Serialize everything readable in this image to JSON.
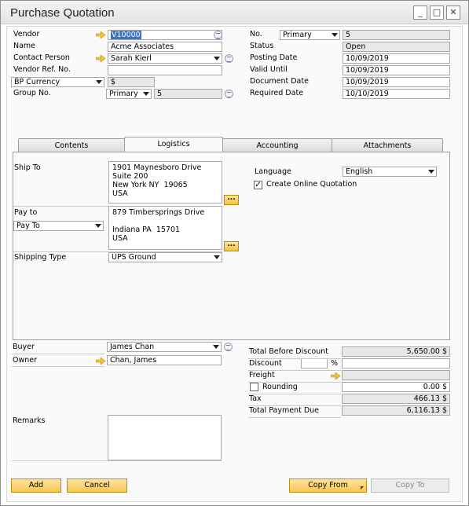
{
  "window": {
    "title": "Purchase Quotation"
  },
  "header_left": {
    "vendor_label": "Vendor",
    "vendor_value": "V10000",
    "name_label": "Name",
    "name_value": "Acme Associates",
    "contact_label": "Contact Person",
    "contact_value": "Sarah Kierl",
    "vendor_ref_label": "Vendor Ref. No.",
    "vendor_ref_value": "",
    "currency_select": "BP Currency",
    "currency_value": "$",
    "group_label": "Group No.",
    "group_select": "Primary",
    "group_value": "5"
  },
  "header_right": {
    "no_label": "No.",
    "no_series": "Primary",
    "no_value": "5",
    "status_label": "Status",
    "status_value": "Open",
    "posting_label": "Posting Date",
    "posting_value": "10/09/2019",
    "valid_label": "Valid Until",
    "valid_value": "10/09/2019",
    "document_label": "Document Date",
    "document_value": "10/09/2019",
    "required_label": "Required Date",
    "required_value": "10/10/2019"
  },
  "tabs": [
    {
      "label": "Contents"
    },
    {
      "label": "Logistics"
    },
    {
      "label": "Accounting"
    },
    {
      "label": "Attachments"
    }
  ],
  "logistics": {
    "ship_to_label": "Ship To",
    "ship_to_address": "1901 Maynesboro Drive\nSuite 200\nNew York NY  19065\nUSA",
    "pay_to_label": "Pay to",
    "pay_to_select": "Pay To",
    "pay_to_address": "879 Timbersprings Drive\n\nIndiana PA  15701\nUSA",
    "shipping_type_label": "Shipping Type",
    "shipping_type_value": "UPS Ground",
    "language_label": "Language",
    "language_value": "English",
    "create_online_label": "Create Online Quotation",
    "dots_label": "..."
  },
  "footer_left": {
    "buyer_label": "Buyer",
    "buyer_value": "James Chan",
    "owner_label": "Owner",
    "owner_value": "Chan, James",
    "remarks_label": "Remarks",
    "remarks_value": ""
  },
  "totals": {
    "total_before_label": "Total Before Discount",
    "total_before_value": "5,650.00 $",
    "discount_label": "Discount",
    "discount_pct": "",
    "pct_sign": "%",
    "discount_value": "",
    "freight_label": "Freight",
    "freight_value": "",
    "rounding_label": "Rounding",
    "rounding_value": "0.00 $",
    "tax_label": "Tax",
    "tax_value": "466.13 $",
    "total_due_label": "Total Payment Due",
    "total_due_value": "6,116.13 $"
  },
  "buttons": {
    "add": "Add",
    "cancel": "Cancel",
    "copy_from": "Copy From",
    "copy_to": "Copy To"
  },
  "window_controls": {
    "minimize": "_",
    "maximize": "□",
    "close": "✕"
  },
  "icons": {
    "link_arrow": "link-arrow-icon",
    "choose_list": "choose-from-list-icon"
  }
}
